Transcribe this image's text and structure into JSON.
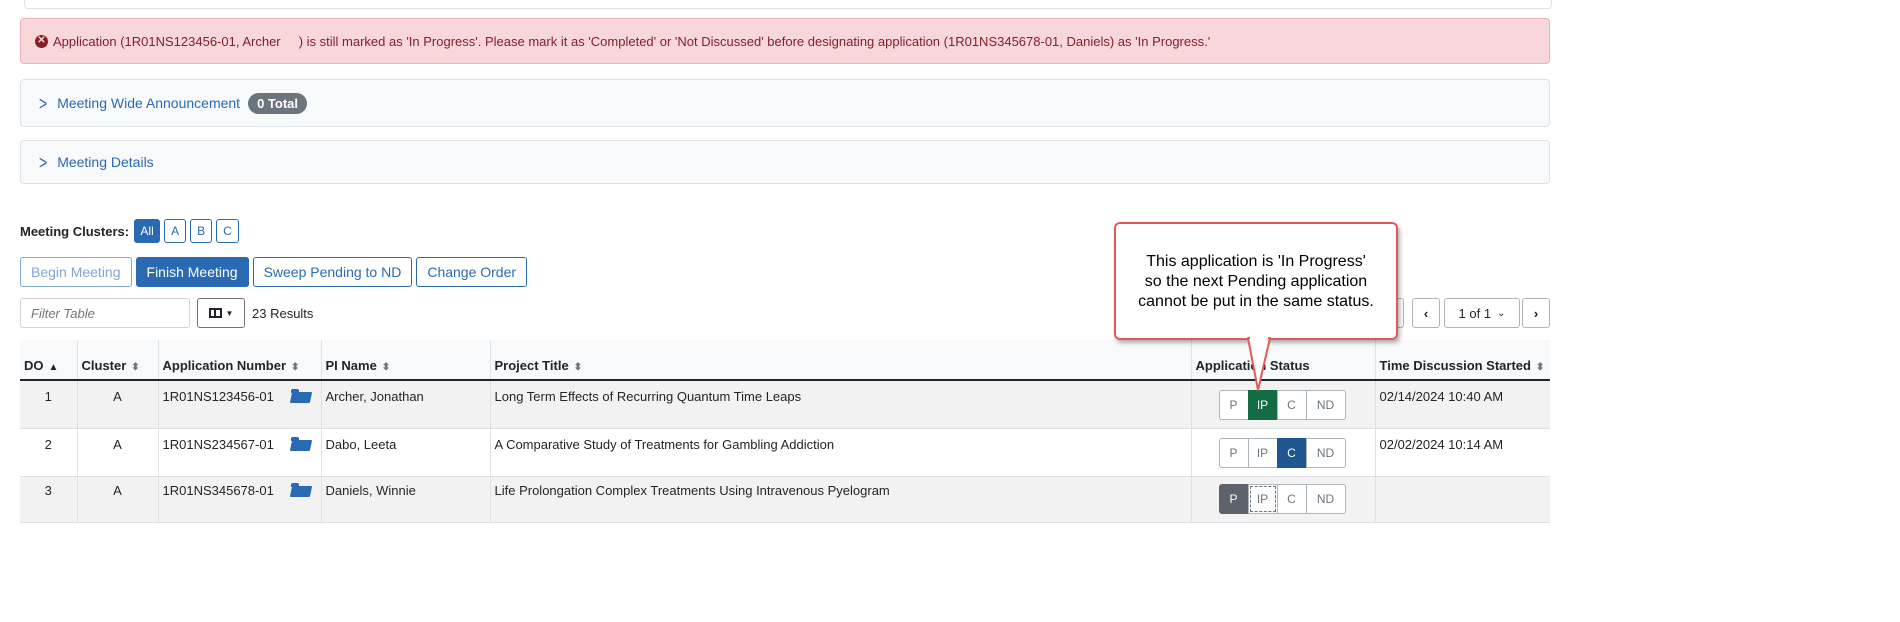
{
  "alert": {
    "message": "Application (1R01NS123456-01, Archer     ) is still marked as 'In Progress'. Please mark it as 'Completed' or 'Not Discussed' before designating application (1R01NS345678-01, Daniels) as 'In Progress.'",
    "color": "#f8d7da"
  },
  "panels": {
    "announcement": {
      "label": "Meeting Wide Announcement",
      "badge": "0 Total"
    },
    "details": {
      "label": "Meeting Details"
    }
  },
  "clusters": {
    "label": "Meeting Clusters:",
    "options": [
      "All",
      "A",
      "B",
      "C"
    ]
  },
  "actions": {
    "begin": "Begin Meeting",
    "finish": "Finish Meeting",
    "sweep": "Sweep Pending to ND",
    "order": "Change Order"
  },
  "toolbar": {
    "filter_placeholder": "Filter Table",
    "results": "23 Results",
    "page": "1 of 1"
  },
  "table": {
    "headers": {
      "do": "DO",
      "cluster": "Cluster",
      "appnum": "Application Number",
      "pi": "PI Name",
      "title": "Project Title",
      "status": "Application Status",
      "time": "Time Discussion Started"
    },
    "rows": [
      {
        "do": "1",
        "cluster": "A",
        "appnum": "1R01NS123456-01",
        "pi": "Archer, Jonathan",
        "title": "Long Term Effects of Recurring  Quantum Time Leaps",
        "status": "IP",
        "time": "02/14/2024 10:40 AM"
      },
      {
        "do": "2",
        "cluster": "A",
        "appnum": "1R01NS234567-01",
        "pi": "Dabo, Leeta",
        "title": "A Comparative Study of Treatments for Gambling Addiction",
        "status": "C",
        "time": "02/02/2024 10:14 AM"
      },
      {
        "do": "3",
        "cluster": "A",
        "appnum": "1R01NS345678-01",
        "pi": "Daniels, Winnie",
        "title": "Life Prolongation Complex Treatments Using Intravenous Pyelogram",
        "status": "P",
        "time": ""
      }
    ],
    "status_options": [
      "P",
      "IP",
      "C",
      "ND"
    ]
  },
  "callout": {
    "line1": "This application is 'In Progress'",
    "line2": "so the next Pending application",
    "line3": "cannot be put in the same status."
  },
  "colors": {
    "primary": "#2a6ab3",
    "in_progress": "#146c43",
    "completed": "#1d5690",
    "pending": "#5c636a",
    "callout_border": "#e15a5a"
  }
}
